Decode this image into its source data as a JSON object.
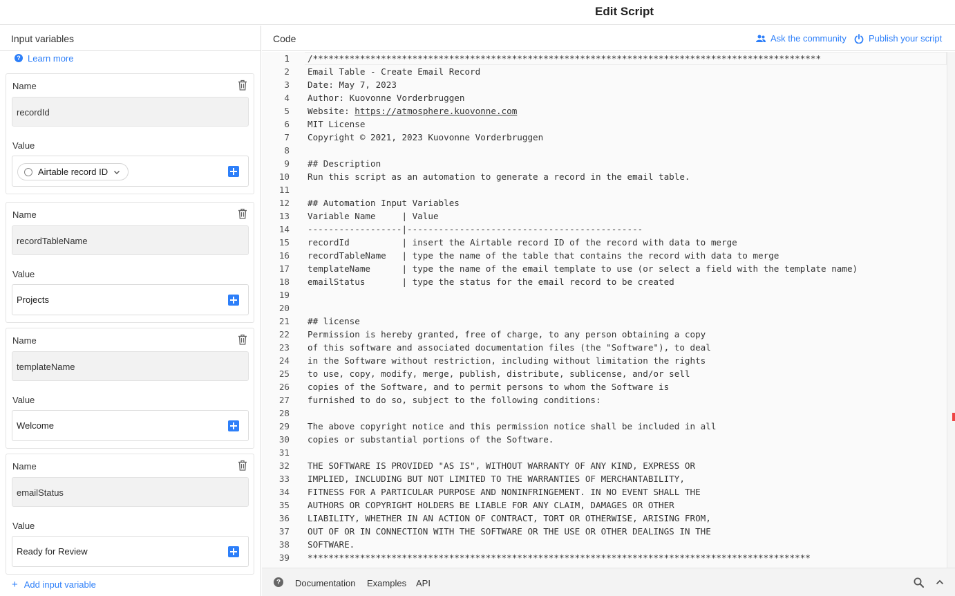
{
  "title": "Edit Script",
  "left_panel": {
    "header": "Input variables",
    "learn_more": "Learn more",
    "name_label": "Name",
    "value_label": "Value",
    "variables": [
      {
        "name": "recordId",
        "value": "Airtable record ID",
        "value_kind": "token"
      },
      {
        "name": "recordTableName",
        "value": "Projects",
        "value_kind": "text"
      },
      {
        "name": "templateName",
        "value": "Welcome",
        "value_kind": "text"
      },
      {
        "name": "emailStatus",
        "value": "Ready for Review",
        "value_kind": "text"
      }
    ],
    "add_variable": "Add input variable"
  },
  "code_pane": {
    "header": "Code",
    "ask_community": "Ask the community",
    "publish_script": "Publish your script",
    "lines": [
      "/*************************************************************************************************",
      "Email Table - Create Email Record",
      "Date: May 7, 2023",
      "Author: Kuovonne Vorderbruggen",
      "Website: https://atmosphere.kuovonne.com",
      "MIT License",
      "Copyright © 2021, 2023 Kuovonne Vorderbruggen",
      "",
      "## Description",
      "Run this script as an automation to generate a record in the email table.",
      "",
      "## Automation Input Variables",
      "Variable Name     | Value",
      "------------------|---------------------------------------------",
      "recordId          | insert the Airtable record ID of the record with data to merge",
      "recordTableName   | type the name of the table that contains the record with data to merge",
      "templateName      | type the name of the email template to use (or select a field with the template name)",
      "emailStatus       | type the status for the email record to be created",
      "",
      "",
      "## license",
      "Permission is hereby granted, free of charge, to any person obtaining a copy",
      "of this software and associated documentation files (the \"Software\"), to deal",
      "in the Software without restriction, including without limitation the rights",
      "to use, copy, modify, merge, publish, distribute, sublicense, and/or sell",
      "copies of the Software, and to permit persons to whom the Software is",
      "furnished to do so, subject to the following conditions:",
      "",
      "The above copyright notice and this permission notice shall be included in all",
      "copies or substantial portions of the Software.",
      "",
      "THE SOFTWARE IS PROVIDED \"AS IS\", WITHOUT WARRANTY OF ANY KIND, EXPRESS OR",
      "IMPLIED, INCLUDING BUT NOT LIMITED TO THE WARRANTIES OF MERCHANTABILITY,",
      "FITNESS FOR A PARTICULAR PURPOSE AND NONINFRINGEMENT. IN NO EVENT SHALL THE",
      "AUTHORS OR COPYRIGHT HOLDERS BE LIABLE FOR ANY CLAIM, DAMAGES OR OTHER",
      "LIABILITY, WHETHER IN AN ACTION OF CONTRACT, TORT OR OTHERWISE, ARISING FROM,",
      "OUT OF OR IN CONNECTION WITH THE SOFTWARE OR THE USE OR OTHER DEALINGS IN THE",
      "SOFTWARE.",
      "************************************************************************************************"
    ],
    "link_text": "https://atmosphere.kuovonne.com",
    "current_line": 1
  },
  "footer": {
    "links": [
      "Documentation",
      "Examples",
      "API"
    ]
  },
  "colors": {
    "accent": "#2d7ff9",
    "error_marker": "#ee4444"
  },
  "icons": [
    "help-icon",
    "trash-icon",
    "plus-icon",
    "record-id-icon",
    "chevron-down-icon",
    "community-icon",
    "publish-icon",
    "search-icon",
    "chevron-up-icon"
  ]
}
